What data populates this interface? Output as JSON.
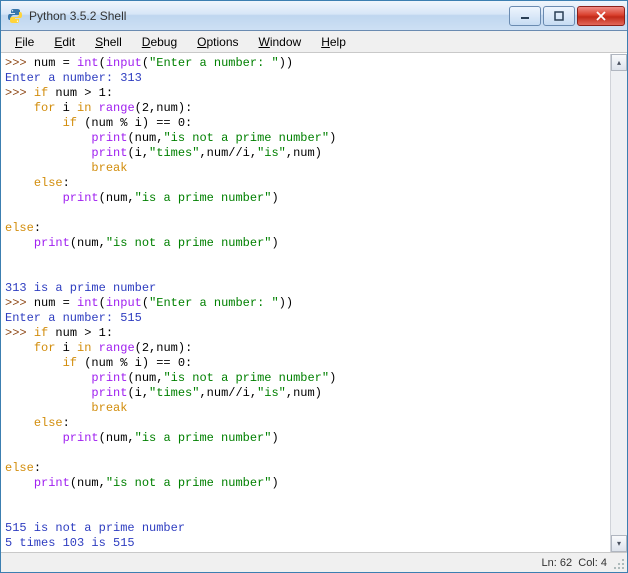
{
  "window": {
    "title": "Python 3.5.2 Shell"
  },
  "menu": {
    "items": [
      {
        "label": "File",
        "ul": "F",
        "rest": "ile"
      },
      {
        "label": "Edit",
        "ul": "E",
        "rest": "dit"
      },
      {
        "label": "Shell",
        "ul": "S",
        "rest": "hell"
      },
      {
        "label": "Debug",
        "ul": "D",
        "rest": "ebug"
      },
      {
        "label": "Options",
        "ul": "O",
        "rest": "ptions"
      },
      {
        "label": "Window",
        "ul": "W",
        "rest": "indow"
      },
      {
        "label": "Help",
        "ul": "H",
        "rest": "elp"
      }
    ]
  },
  "status": {
    "ln_label": "Ln:",
    "ln_value": "62",
    "col_label": "Col:",
    "col_value": "4"
  },
  "code": {
    "lines": [
      {
        "t": "stmt",
        "parts": [
          {
            "c": "prompt",
            "s": ">>> "
          },
          {
            "c": "id",
            "s": "num = "
          },
          {
            "c": "builtin",
            "s": "int"
          },
          {
            "c": "id",
            "s": "("
          },
          {
            "c": "builtin",
            "s": "input"
          },
          {
            "c": "id",
            "s": "("
          },
          {
            "c": "str",
            "s": "\"Enter a number: \""
          },
          {
            "c": "id",
            "s": "))"
          }
        ]
      },
      {
        "t": "out",
        "parts": [
          {
            "c": "out",
            "s": "Enter a number: 313"
          }
        ]
      },
      {
        "t": "stmt",
        "parts": [
          {
            "c": "prompt",
            "s": ">>> "
          },
          {
            "c": "kw",
            "s": "if"
          },
          {
            "c": "id",
            "s": " num > 1:"
          }
        ]
      },
      {
        "t": "stmt",
        "parts": [
          {
            "c": "id",
            "s": "    "
          },
          {
            "c": "kw",
            "s": "for"
          },
          {
            "c": "id",
            "s": " i "
          },
          {
            "c": "kw",
            "s": "in"
          },
          {
            "c": "id",
            "s": " "
          },
          {
            "c": "builtin",
            "s": "range"
          },
          {
            "c": "id",
            "s": "(2,num):"
          }
        ]
      },
      {
        "t": "stmt",
        "parts": [
          {
            "c": "id",
            "s": "        "
          },
          {
            "c": "kw",
            "s": "if"
          },
          {
            "c": "id",
            "s": " (num % i) == 0:"
          }
        ]
      },
      {
        "t": "stmt",
        "parts": [
          {
            "c": "id",
            "s": "            "
          },
          {
            "c": "builtin",
            "s": "print"
          },
          {
            "c": "id",
            "s": "(num,"
          },
          {
            "c": "str",
            "s": "\"is not a prime number\""
          },
          {
            "c": "id",
            "s": ")"
          }
        ]
      },
      {
        "t": "stmt",
        "parts": [
          {
            "c": "id",
            "s": "            "
          },
          {
            "c": "builtin",
            "s": "print"
          },
          {
            "c": "id",
            "s": "(i,"
          },
          {
            "c": "str",
            "s": "\"times\""
          },
          {
            "c": "id",
            "s": ",num//i,"
          },
          {
            "c": "str",
            "s": "\"is\""
          },
          {
            "c": "id",
            "s": ",num)"
          }
        ]
      },
      {
        "t": "stmt",
        "parts": [
          {
            "c": "id",
            "s": "            "
          },
          {
            "c": "kw",
            "s": "break"
          }
        ]
      },
      {
        "t": "stmt",
        "parts": [
          {
            "c": "id",
            "s": "    "
          },
          {
            "c": "kw",
            "s": "else"
          },
          {
            "c": "id",
            "s": ":"
          }
        ]
      },
      {
        "t": "stmt",
        "parts": [
          {
            "c": "id",
            "s": "        "
          },
          {
            "c": "builtin",
            "s": "print"
          },
          {
            "c": "id",
            "s": "(num,"
          },
          {
            "c": "str",
            "s": "\"is a prime number\""
          },
          {
            "c": "id",
            "s": ")"
          }
        ]
      },
      {
        "t": "blank",
        "parts": [
          {
            "c": "id",
            "s": ""
          }
        ]
      },
      {
        "t": "stmt",
        "parts": [
          {
            "c": "kw",
            "s": "else"
          },
          {
            "c": "id",
            "s": ":"
          }
        ]
      },
      {
        "t": "stmt",
        "parts": [
          {
            "c": "id",
            "s": "    "
          },
          {
            "c": "builtin",
            "s": "print"
          },
          {
            "c": "id",
            "s": "(num,"
          },
          {
            "c": "str",
            "s": "\"is not a prime number\""
          },
          {
            "c": "id",
            "s": ")"
          }
        ]
      },
      {
        "t": "blank",
        "parts": [
          {
            "c": "id",
            "s": ""
          }
        ]
      },
      {
        "t": "blank",
        "parts": [
          {
            "c": "id",
            "s": ""
          }
        ]
      },
      {
        "t": "out",
        "parts": [
          {
            "c": "out",
            "s": "313 is a prime number"
          }
        ]
      },
      {
        "t": "stmt",
        "parts": [
          {
            "c": "prompt",
            "s": ">>> "
          },
          {
            "c": "id",
            "s": "num = "
          },
          {
            "c": "builtin",
            "s": "int"
          },
          {
            "c": "id",
            "s": "("
          },
          {
            "c": "builtin",
            "s": "input"
          },
          {
            "c": "id",
            "s": "("
          },
          {
            "c": "str",
            "s": "\"Enter a number: \""
          },
          {
            "c": "id",
            "s": "))"
          }
        ]
      },
      {
        "t": "out",
        "parts": [
          {
            "c": "out",
            "s": "Enter a number: 515"
          }
        ]
      },
      {
        "t": "stmt",
        "parts": [
          {
            "c": "prompt",
            "s": ">>> "
          },
          {
            "c": "kw",
            "s": "if"
          },
          {
            "c": "id",
            "s": " num > 1:"
          }
        ]
      },
      {
        "t": "stmt",
        "parts": [
          {
            "c": "id",
            "s": "    "
          },
          {
            "c": "kw",
            "s": "for"
          },
          {
            "c": "id",
            "s": " i "
          },
          {
            "c": "kw",
            "s": "in"
          },
          {
            "c": "id",
            "s": " "
          },
          {
            "c": "builtin",
            "s": "range"
          },
          {
            "c": "id",
            "s": "(2,num):"
          }
        ]
      },
      {
        "t": "stmt",
        "parts": [
          {
            "c": "id",
            "s": "        "
          },
          {
            "c": "kw",
            "s": "if"
          },
          {
            "c": "id",
            "s": " (num % i) == 0:"
          }
        ]
      },
      {
        "t": "stmt",
        "parts": [
          {
            "c": "id",
            "s": "            "
          },
          {
            "c": "builtin",
            "s": "print"
          },
          {
            "c": "id",
            "s": "(num,"
          },
          {
            "c": "str",
            "s": "\"is not a prime number\""
          },
          {
            "c": "id",
            "s": ")"
          }
        ]
      },
      {
        "t": "stmt",
        "parts": [
          {
            "c": "id",
            "s": "            "
          },
          {
            "c": "builtin",
            "s": "print"
          },
          {
            "c": "id",
            "s": "(i,"
          },
          {
            "c": "str",
            "s": "\"times\""
          },
          {
            "c": "id",
            "s": ",num//i,"
          },
          {
            "c": "str",
            "s": "\"is\""
          },
          {
            "c": "id",
            "s": ",num)"
          }
        ]
      },
      {
        "t": "stmt",
        "parts": [
          {
            "c": "id",
            "s": "            "
          },
          {
            "c": "kw",
            "s": "break"
          }
        ]
      },
      {
        "t": "stmt",
        "parts": [
          {
            "c": "id",
            "s": "    "
          },
          {
            "c": "kw",
            "s": "else"
          },
          {
            "c": "id",
            "s": ":"
          }
        ]
      },
      {
        "t": "stmt",
        "parts": [
          {
            "c": "id",
            "s": "        "
          },
          {
            "c": "builtin",
            "s": "print"
          },
          {
            "c": "id",
            "s": "(num,"
          },
          {
            "c": "str",
            "s": "\"is a prime number\""
          },
          {
            "c": "id",
            "s": ")"
          }
        ]
      },
      {
        "t": "blank",
        "parts": [
          {
            "c": "id",
            "s": ""
          }
        ]
      },
      {
        "t": "stmt",
        "parts": [
          {
            "c": "kw",
            "s": "else"
          },
          {
            "c": "id",
            "s": ":"
          }
        ]
      },
      {
        "t": "stmt",
        "parts": [
          {
            "c": "id",
            "s": "    "
          },
          {
            "c": "builtin",
            "s": "print"
          },
          {
            "c": "id",
            "s": "(num,"
          },
          {
            "c": "str",
            "s": "\"is not a prime number\""
          },
          {
            "c": "id",
            "s": ")"
          }
        ]
      },
      {
        "t": "blank",
        "parts": [
          {
            "c": "id",
            "s": ""
          }
        ]
      },
      {
        "t": "blank",
        "parts": [
          {
            "c": "id",
            "s": ""
          }
        ]
      },
      {
        "t": "out",
        "parts": [
          {
            "c": "out",
            "s": "515 is not a prime number"
          }
        ]
      },
      {
        "t": "out",
        "parts": [
          {
            "c": "out",
            "s": "5 times 103 is 515"
          }
        ]
      },
      {
        "t": "stmt",
        "parts": [
          {
            "c": "prompt",
            "s": ">>> "
          }
        ],
        "cursor": true
      }
    ]
  }
}
